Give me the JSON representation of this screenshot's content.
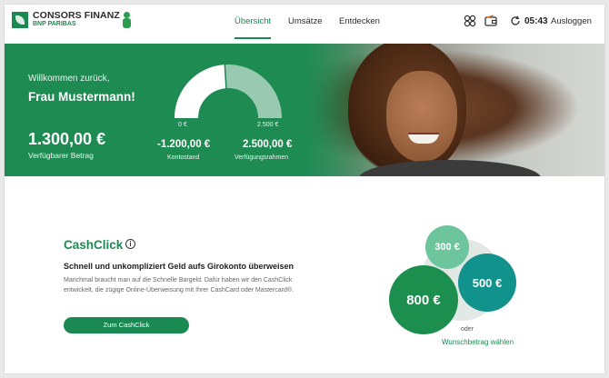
{
  "header": {
    "logo_main": "CONSORS FINANZ",
    "logo_sub": "BNP PARIBAS",
    "nav": [
      "Übersicht",
      "Umsätze",
      "Entdecken"
    ],
    "timer": "05:43",
    "logout": "Ausloggen"
  },
  "hero": {
    "welcome": "Willkommen zurück,",
    "name": "Frau Mustermann!",
    "available_value": "1.300,00 €",
    "available_label": "Verfügbarer Betrag",
    "gauge_min": "0 €",
    "gauge_max": "2.500 €",
    "gauge_fill_fraction": 0.48,
    "kontostand_value": "-1.200,00 €",
    "kontostand_label": "Kontostand",
    "rahmen_value": "2.500,00 €",
    "rahmen_label": "Verfügungsrahmen"
  },
  "cashclick": {
    "title": "CashClick",
    "subtitle": "Schnell und unkompliziert Geld aufs Girokonto überweisen",
    "body": "Manchmal braucht man auf die Schnelle Bargeld. Dafür haben wir den CashClick entwickelt, die zügige Online-Überweisung mit Ihrer CashCard oder Mastercard®.",
    "button": "Zum CashClick",
    "amounts": [
      "300 €",
      "500 €",
      "800 €"
    ],
    "or": "oder",
    "custom": "Wunschbetrag wählen"
  },
  "colors": {
    "brand_green": "#1b8a52",
    "teal": "#12928d",
    "light_green": "#6cc59c"
  }
}
